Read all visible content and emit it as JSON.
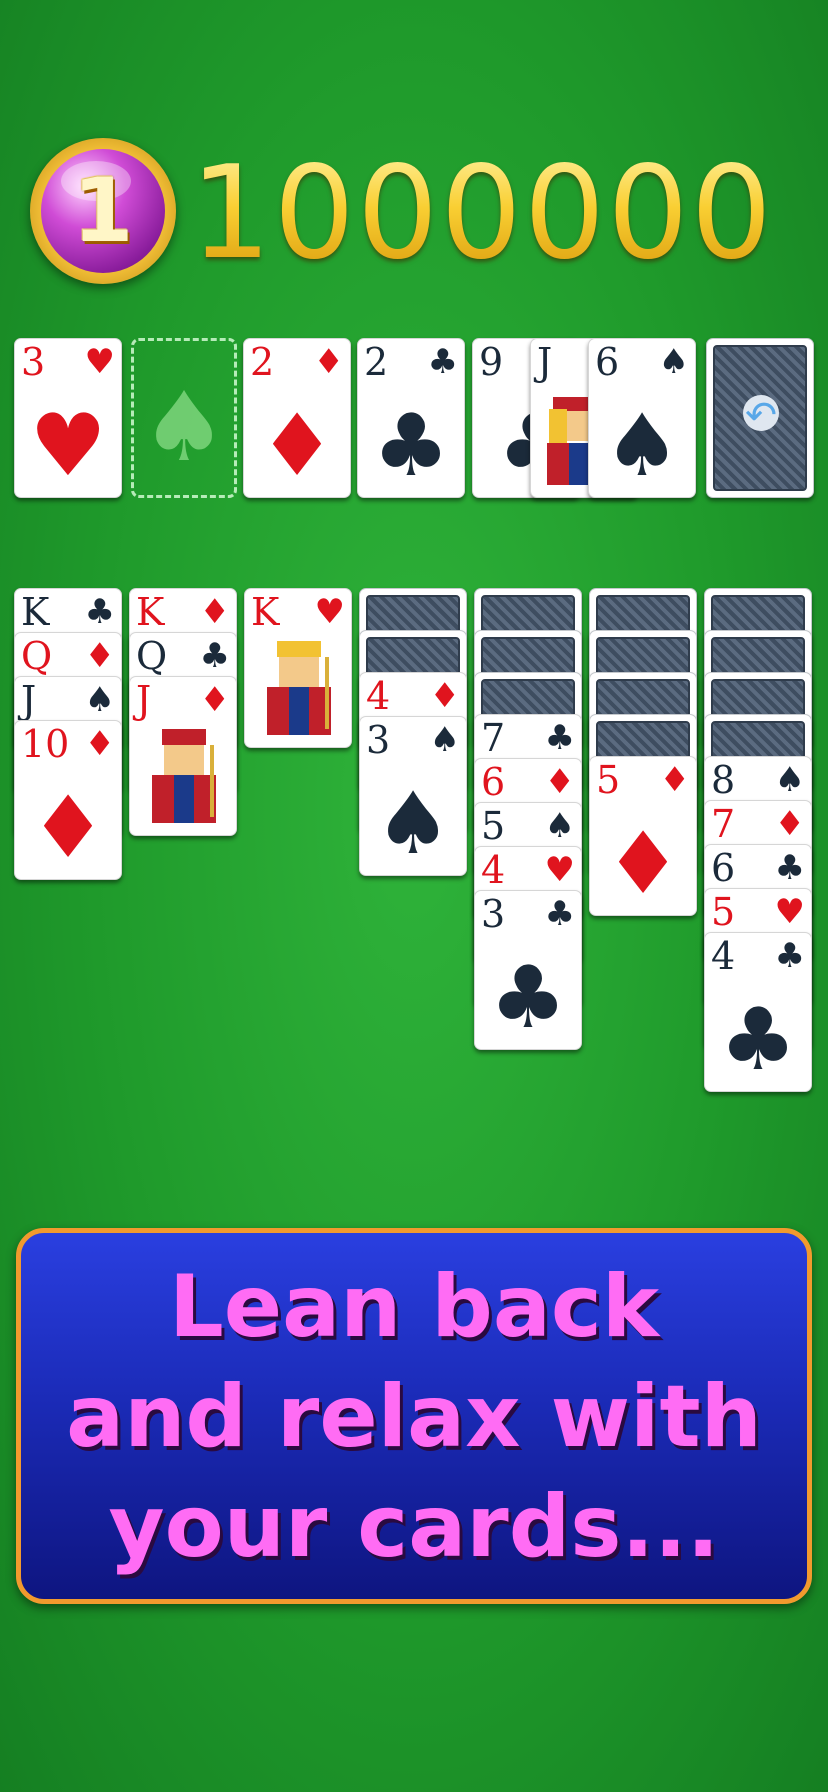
{
  "header": {
    "level": "1",
    "score": "1000000"
  },
  "foundation": [
    {
      "rank": "3",
      "suit": "♥",
      "color": "red"
    },
    {
      "placeholder": "♠"
    },
    {
      "rank": "2",
      "suit": "♦",
      "color": "red"
    },
    {
      "rank": "2",
      "suit": "♣",
      "color": "black"
    }
  ],
  "waste": [
    {
      "rank": "9",
      "suit": "♣",
      "color": "black"
    },
    {
      "rank": "J",
      "suit": "♣",
      "color": "black"
    },
    {
      "rank": "6",
      "suit": "♠",
      "color": "black"
    }
  ],
  "stock": {
    "icon": "undo-arrow-icon",
    "symbol": "↶"
  },
  "tableau": [
    {
      "cards": [
        {
          "rank": "K",
          "suit": "♣",
          "color": "black"
        },
        {
          "rank": "Q",
          "suit": "♦",
          "color": "red"
        },
        {
          "rank": "J",
          "suit": "♠",
          "color": "black"
        },
        {
          "rank": "10",
          "suit": "♦",
          "color": "red"
        }
      ]
    },
    {
      "cards": [
        {
          "rank": "K",
          "suit": "♦",
          "color": "red"
        },
        {
          "rank": "Q",
          "suit": "♣",
          "color": "black"
        },
        {
          "rank": "J",
          "suit": "♦",
          "color": "red"
        }
      ]
    },
    {
      "cards": [
        {
          "rank": "K",
          "suit": "♥",
          "color": "red"
        }
      ]
    },
    {
      "hidden": 2,
      "cards": [
        {
          "rank": "4",
          "suit": "♦",
          "color": "red"
        },
        {
          "rank": "3",
          "suit": "♠",
          "color": "black"
        }
      ]
    },
    {
      "hidden": 3,
      "cards": [
        {
          "rank": "7",
          "suit": "♣",
          "color": "black"
        },
        {
          "rank": "6",
          "suit": "♦",
          "color": "red"
        },
        {
          "rank": "5",
          "suit": "♠",
          "color": "black"
        },
        {
          "rank": "4",
          "suit": "♥",
          "color": "red"
        },
        {
          "rank": "3",
          "suit": "♣",
          "color": "black"
        }
      ]
    },
    {
      "hidden": 4,
      "cards": [
        {
          "rank": "5",
          "suit": "♦",
          "color": "red"
        }
      ]
    },
    {
      "hidden": 4,
      "cards": [
        {
          "rank": "8",
          "suit": "♠",
          "color": "black"
        },
        {
          "rank": "7",
          "suit": "♦",
          "color": "red"
        },
        {
          "rank": "6",
          "suit": "♣",
          "color": "black"
        },
        {
          "rank": "5",
          "suit": "♥",
          "color": "red"
        },
        {
          "rank": "4",
          "suit": "♣",
          "color": "black"
        }
      ]
    }
  ],
  "banner": {
    "line1": "Lean back",
    "line2": "and relax with",
    "line3": "your cards..."
  },
  "colors": {
    "felt": "#1f9a2b",
    "banner_bg": "#1b2bb8",
    "banner_border": "#f29a2e",
    "banner_text": "#ff6cf4",
    "score_gold": "#f5c526"
  }
}
